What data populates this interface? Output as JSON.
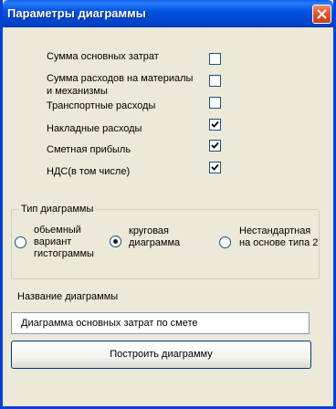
{
  "window": {
    "title": "Параметры диаграммы"
  },
  "checkboxes": [
    {
      "label": "Сумма основных затрат",
      "checked": false
    },
    {
      "label": "Сумма расходов на материалы\nи механизмы",
      "checked": false
    },
    {
      "label": "Транспортные расходы",
      "checked": false
    },
    {
      "label": "Накладные расходы",
      "checked": true
    },
    {
      "label": "Сметная прибыль",
      "checked": true
    },
    {
      "label": "НДС(в том числе)",
      "checked": true
    }
  ],
  "chart_type": {
    "title": "Тип диаграммы",
    "options": [
      {
        "label": "обьемный\nвариант\nгистограммы",
        "selected": false
      },
      {
        "label": "круговая\nдиаграмма",
        "selected": true
      },
      {
        "label": "Нестандартная\nна основе типа 2",
        "selected": false
      }
    ]
  },
  "chart_name": {
    "label": "Название диаграммы",
    "value": "Диаграмма основных затрат по смете"
  },
  "build_button": {
    "label": "Построить диаграмму"
  },
  "icons": {
    "close": "close-icon",
    "check": "checkmark-icon"
  }
}
